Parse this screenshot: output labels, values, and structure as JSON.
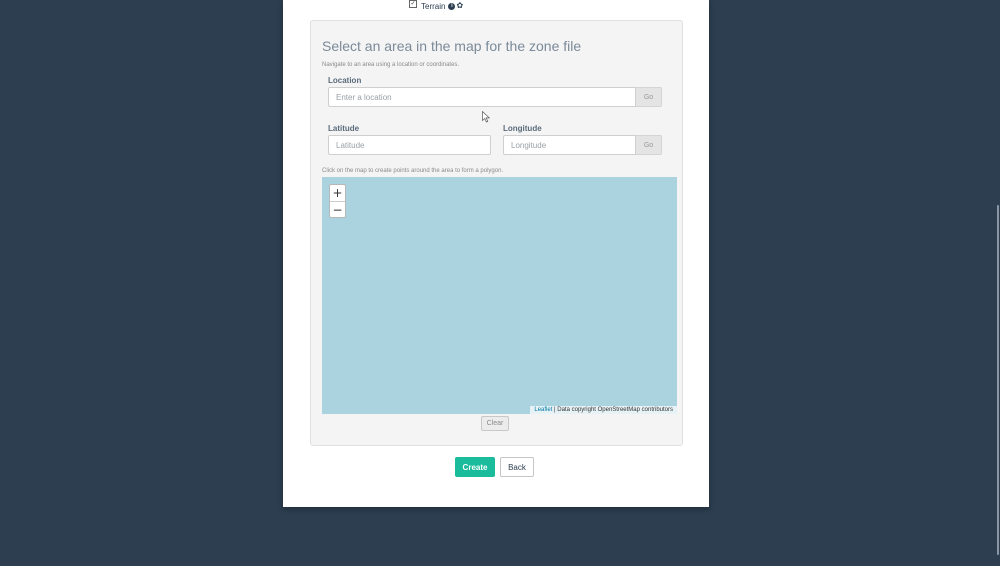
{
  "layer": {
    "checked": true,
    "label": "Terrain",
    "info_icon": "info-circle-icon",
    "settings_icon": "gear-icon"
  },
  "zone": {
    "title": "Select an area in the map for the zone file",
    "hint": "Navigate to an area using a location or coordinates.",
    "location": {
      "label": "Location",
      "placeholder": "Enter a location",
      "value": "",
      "go_label": "Go"
    },
    "latitude": {
      "label": "Latitude",
      "placeholder": "Latitude",
      "value": ""
    },
    "longitude": {
      "label": "Longitude",
      "placeholder": "Longitude",
      "value": "",
      "go_label": "Go"
    },
    "map_hint": "Click on the map to create points around the area to form a polygon."
  },
  "map": {
    "zoom_in": "+",
    "zoom_out": "−",
    "attribution_link": "Leaflet",
    "attribution_text": " | Data copyright OpenStreetMap contributors",
    "water_color": "#aad3df"
  },
  "actions": {
    "clear_label": "Clear",
    "create_label": "Create",
    "back_label": "Back"
  },
  "colors": {
    "background": "#2c3e50",
    "accent": "#1abc9c"
  }
}
